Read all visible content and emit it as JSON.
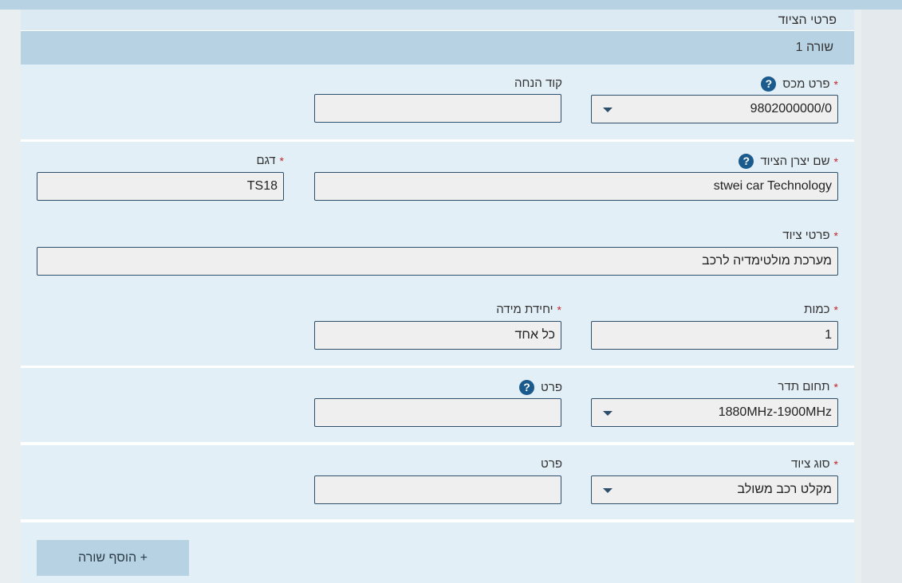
{
  "section": {
    "title": "פרטי הציוד"
  },
  "row": {
    "title": "שורה 1"
  },
  "fields": {
    "customs_item": {
      "label": "פרט מכס",
      "value": "9802000000/0",
      "required": true
    },
    "discount_code": {
      "label": "קוד הנחה",
      "value": ""
    },
    "manufacturer_name": {
      "label": "שם יצרן הציוד",
      "value": "stwei car Technology",
      "required": true
    },
    "model": {
      "label": "דגם",
      "value": "TS18",
      "required": true
    },
    "equipment_details": {
      "label": "פרטי ציוד",
      "value": "מערכת מולטימדיה לרכב",
      "required": true
    },
    "quantity": {
      "label": "כמות",
      "value": "1",
      "required": true
    },
    "unit": {
      "label": "יחידת מידה",
      "value": "כל אחד",
      "required": true
    },
    "frequency_range": {
      "label": "תחום תדר",
      "value": "1880MHz-1900MHz",
      "required": true
    },
    "frequency_detail": {
      "label": "פרט",
      "value": ""
    },
    "equipment_type": {
      "label": "סוג ציוד",
      "value": "מקלט רכב משולב",
      "required": true
    },
    "type_detail": {
      "label": "פרט",
      "value": ""
    }
  },
  "required_mark": "*",
  "help_glyph": "?",
  "buttons": {
    "add_row": "+ הוסף שורה"
  },
  "colors": {
    "header": "#b7d2e3",
    "block": "#e2eff7",
    "required": "#c0262d",
    "help": "#1b5a8c"
  },
  "icons": {
    "help": "question-circle-icon",
    "dropdown": "chevron-down-icon"
  }
}
